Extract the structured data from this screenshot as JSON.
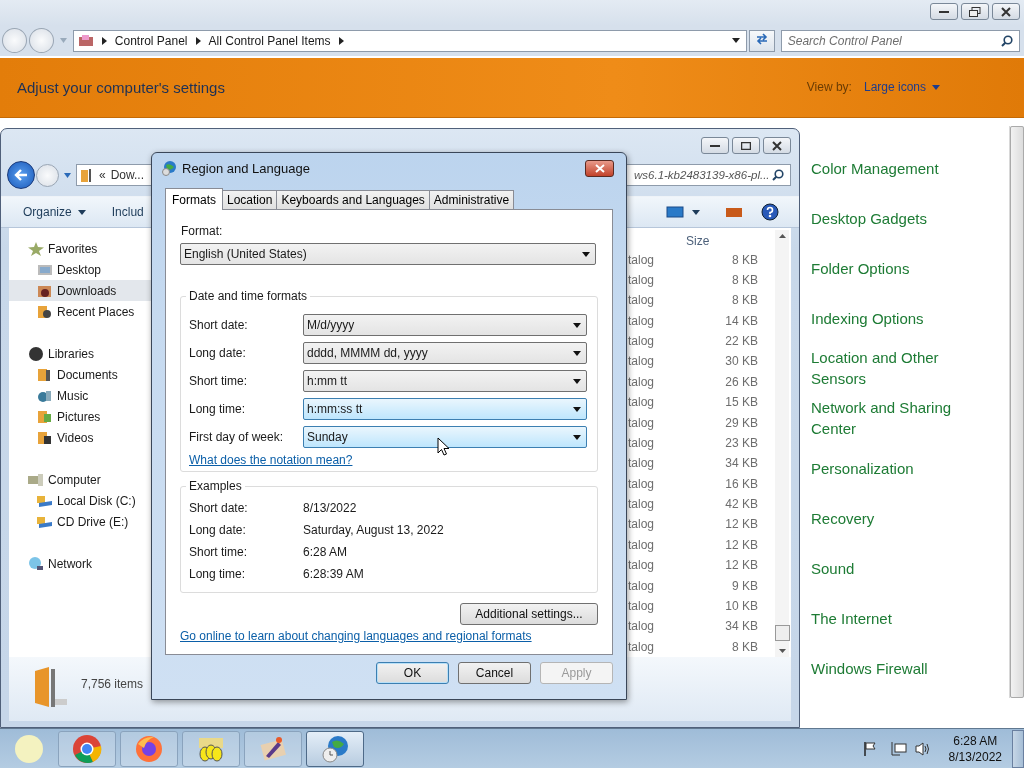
{
  "control_panel": {
    "breadcrumb": [
      "Control Panel",
      "All Control Panel Items"
    ],
    "search": {
      "placeholder": "Search Control Panel"
    },
    "heading": "Adjust your computer's settings",
    "view_by_label": "View by:",
    "view_by_value": "Large icons",
    "items": [
      "Color Management",
      "Desktop Gadgets",
      "Folder Options",
      "Indexing Options",
      "Location and Other Sensors",
      "Network and Sharing Center",
      "Personalization",
      "Recovery",
      "Sound",
      "The Internet",
      "Windows Firewall"
    ]
  },
  "explorer": {
    "address": [
      "«",
      "Dow..."
    ],
    "search": {
      "value": "ws6.1-kb2483139-x86-pl..."
    },
    "toolbar": [
      {
        "label": "Organize",
        "menu": true
      },
      {
        "label": "Includ",
        "menu": false
      }
    ],
    "nav": [
      {
        "label": "Favorites",
        "kind": "star",
        "selected": false,
        "children": [
          {
            "label": "Desktop",
            "kind": "desktop",
            "selected": false
          },
          {
            "label": "Downloads",
            "kind": "download",
            "selected": true
          },
          {
            "label": "Recent Places",
            "kind": "recent",
            "selected": false
          }
        ]
      },
      {
        "label": "Libraries",
        "kind": "library",
        "selected": false,
        "children": [
          {
            "label": "Documents",
            "kind": "documents",
            "selected": false
          },
          {
            "label": "Music",
            "kind": "music",
            "selected": false
          },
          {
            "label": "Pictures",
            "kind": "pictures",
            "selected": false
          },
          {
            "label": "Videos",
            "kind": "videos",
            "selected": false
          }
        ]
      },
      {
        "label": "Computer",
        "kind": "computer",
        "selected": false,
        "children": [
          {
            "label": "Local Disk (C:)",
            "kind": "disk",
            "selected": false
          },
          {
            "label": "CD Drive (E:)",
            "kind": "disk",
            "selected": false
          }
        ]
      },
      {
        "label": "Network",
        "kind": "network",
        "selected": false
      }
    ],
    "column": "Size",
    "rows": [
      {
        "type": "talog",
        "size": "8 KB"
      },
      {
        "type": "talog",
        "size": "8 KB"
      },
      {
        "type": "talog",
        "size": "8 KB"
      },
      {
        "type": "talog",
        "size": "14 KB"
      },
      {
        "type": "talog",
        "size": "22 KB"
      },
      {
        "type": "talog",
        "size": "30 KB"
      },
      {
        "type": "talog",
        "size": "26 KB"
      },
      {
        "type": "talog",
        "size": "15 KB"
      },
      {
        "type": "talog",
        "size": "29 KB"
      },
      {
        "type": "talog",
        "size": "23 KB"
      },
      {
        "type": "talog",
        "size": "34 KB"
      },
      {
        "type": "talog",
        "size": "16 KB"
      },
      {
        "type": "talog",
        "size": "42 KB"
      },
      {
        "type": "talog",
        "size": "12 KB"
      },
      {
        "type": "talog",
        "size": "12 KB"
      },
      {
        "type": "talog",
        "size": "12 KB"
      },
      {
        "type": "talog",
        "size": "9 KB"
      },
      {
        "type": "talog",
        "size": "10 KB"
      },
      {
        "type": "talog",
        "size": "34 KB"
      },
      {
        "type": "talog",
        "size": "8 KB"
      }
    ],
    "status": "7,756 items"
  },
  "dialog": {
    "title": "Region and Language",
    "tabs": [
      {
        "label": "Formats",
        "selected": true
      },
      {
        "label": "Location",
        "selected": false
      },
      {
        "label": "Keyboards and Languages",
        "selected": false
      },
      {
        "label": "Administrative",
        "selected": false
      }
    ],
    "format_label": "Format:",
    "format_value": "English (United States)",
    "group_title": "Date and time formats",
    "fields": [
      {
        "label": "Short date:",
        "value": "M/d/yyyy",
        "highlighted": false
      },
      {
        "label": "Long date:",
        "value": "dddd, MMMM dd, yyyy",
        "highlighted": false
      },
      {
        "label": "Short time:",
        "value": "h:mm tt",
        "highlighted": false
      },
      {
        "label": "Long time:",
        "value": "h:mm:ss tt",
        "highlighted": true
      },
      {
        "label": "First day of week:",
        "value": "Sunday",
        "highlighted": true
      }
    ],
    "notation_link": "What does the notation mean?",
    "examples_title": "Examples",
    "examples": [
      {
        "label": "Short date:",
        "value": "8/13/2022"
      },
      {
        "label": "Long date:",
        "value": "Saturday, August 13, 2022"
      },
      {
        "label": "Short time:",
        "value": "6:28 AM"
      },
      {
        "label": "Long time:",
        "value": "6:28:39 AM"
      }
    ],
    "additional_button": "Additional settings...",
    "online_link": "Go online to learn about changing languages and regional formats",
    "buttons": [
      {
        "label": "OK",
        "default": true,
        "disabled": false
      },
      {
        "label": "Cancel",
        "default": false,
        "disabled": false
      },
      {
        "label": "Apply",
        "default": false,
        "disabled": true
      }
    ]
  },
  "taskbar": {
    "apps": [
      {
        "kind": "chrome",
        "active": false
      },
      {
        "kind": "firefox",
        "active": false
      },
      {
        "kind": "eggs",
        "active": false
      },
      {
        "kind": "paint",
        "active": false
      },
      {
        "kind": "globe",
        "active": true
      }
    ],
    "time": "6:28 AM",
    "date": "8/13/2022"
  }
}
